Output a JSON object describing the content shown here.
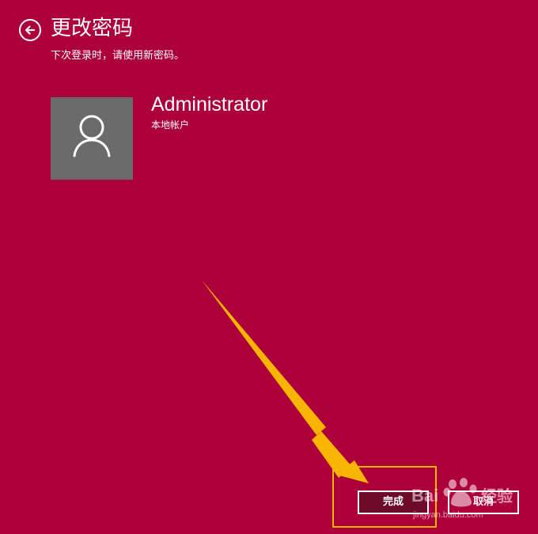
{
  "header": {
    "title": "更改密码",
    "subtitle": "下次登录时，请使用新密码。"
  },
  "account": {
    "name": "Administrator",
    "type": "本地帐户"
  },
  "buttons": {
    "finish_label": "完成",
    "cancel_label": "取消"
  },
  "watermark": {
    "brand": "Bai 经验",
    "url": "jingyan.baidu.com"
  },
  "colors": {
    "background": "#ad003a",
    "avatar_bg": "#6b6b6b",
    "annotation": "#f7b500",
    "finish_bg": "#6e0b2a"
  },
  "icons": {
    "back": "back-arrow-icon",
    "avatar": "user-silhouette-icon",
    "annotation": "arrow-annotation-icon"
  }
}
